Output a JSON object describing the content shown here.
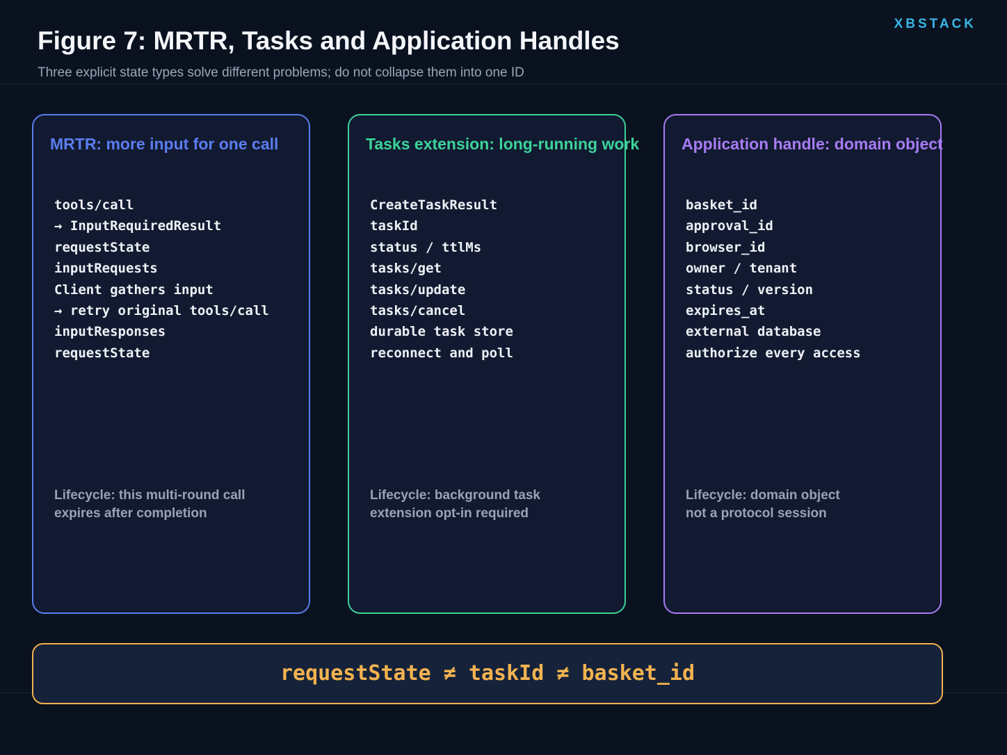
{
  "header": {
    "brand": "XBSTACK",
    "title": "Figure 7: MRTR, Tasks and Application Handles",
    "subtitle": "Three explicit state types solve different problems; do not collapse them into one ID"
  },
  "colors": {
    "background": "#0a1220",
    "panel_fill": "#111a30",
    "mrtr_accent": "#5b7df0",
    "tasks_accent": "#3dd39a",
    "handle_accent": "#a87cf5",
    "bottom_accent": "#f3b34f",
    "brand_accent": "#3ab7e6"
  },
  "panels": [
    {
      "title": "MRTR: more input for one call",
      "items": [
        "tools/call",
        "→ InputRequiredResult",
        "requestState",
        "inputRequests",
        "Client gathers input",
        "→ retry original tools/call",
        "inputResponses",
        "requestState"
      ],
      "lifecycle_lines": [
        "Lifecycle: this multi-round call",
        "expires after completion"
      ]
    },
    {
      "title": "Tasks extension: long-running work",
      "items": [
        "CreateTaskResult",
        "taskId",
        "status / ttlMs",
        "tasks/get",
        "tasks/update",
        "tasks/cancel",
        "durable task store",
        "reconnect and poll"
      ],
      "lifecycle_lines": [
        "Lifecycle: background task",
        "extension opt-in required"
      ]
    },
    {
      "title": "Application handle: domain object",
      "items": [
        "basket_id",
        "approval_id",
        "browser_id",
        "owner / tenant",
        "status / version",
        "expires_at",
        "external database",
        "authorize every access"
      ],
      "lifecycle_lines": [
        "Lifecycle: domain object",
        "not a protocol session"
      ]
    }
  ],
  "bottom": {
    "text": "requestState ≠ taskId ≠ basket_id"
  }
}
